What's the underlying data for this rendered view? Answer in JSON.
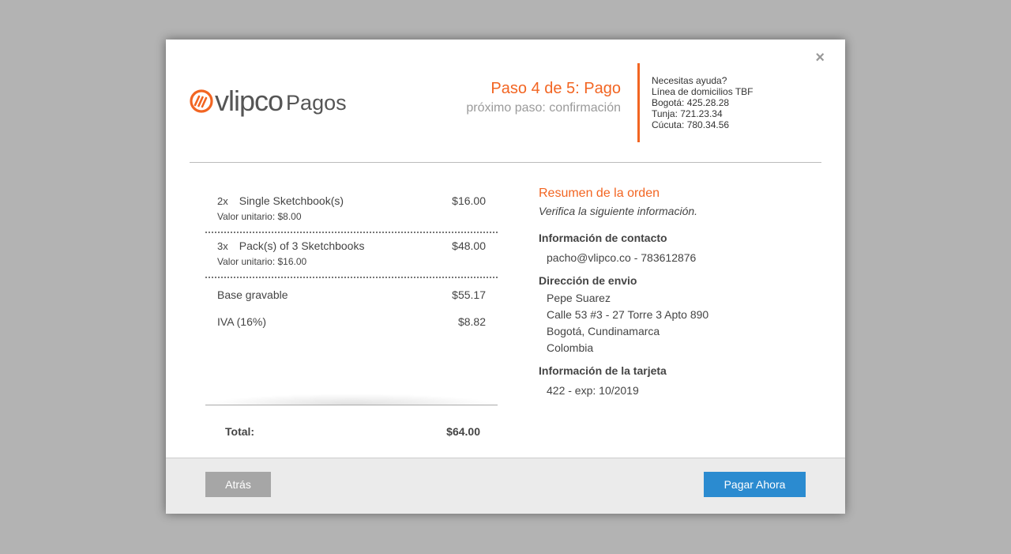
{
  "modal": {
    "close_label": "×"
  },
  "brand": {
    "name": "vlipco",
    "product": "Pagos",
    "accent_color": "#f26522"
  },
  "step": {
    "title": "Paso 4 de 5: Pago",
    "next": "próximo paso: confirmación"
  },
  "help": {
    "title": "Necesitas ayuda?",
    "line": "Línea de domicilios TBF",
    "phones": [
      "Bogotá: 425.28.28",
      "Tunja: 721.23.34",
      "Cúcuta: 780.34.56"
    ]
  },
  "order": {
    "items": [
      {
        "qty": "2x",
        "name": "Single Sketchbook(s)",
        "price": "$16.00",
        "unit": "Valor unitario: $8.00"
      },
      {
        "qty": "3x",
        "name": "Pack(s) of 3 Sketchbooks",
        "price": "$48.00",
        "unit": "Valor unitario: $16.00"
      }
    ],
    "base_label": "Base gravable",
    "base_value": "$55.17",
    "tax_label": "IVA (16%)",
    "tax_value": "$8.82",
    "total_label": "Total:",
    "total_value": "$64.00"
  },
  "summary": {
    "title": "Resumen de la orden",
    "subtitle": "Verifica la siguiente información.",
    "contact_title": "Información de contacto",
    "contact": "pacho@vlipco.co - 783612876",
    "address_title": "Dirección de envio",
    "address_lines": [
      "Pepe Suarez",
      "Calle 53 #3 - 27 Torre 3 Apto 890",
      "Bogotá, Cundinamarca",
      "Colombia"
    ],
    "card_title": "Información de la tarjeta",
    "card": "422 - exp: 10/2019"
  },
  "footer": {
    "back_label": "Atrás",
    "pay_label": "Pagar Ahora",
    "pay_color": "#2b8bd0"
  }
}
